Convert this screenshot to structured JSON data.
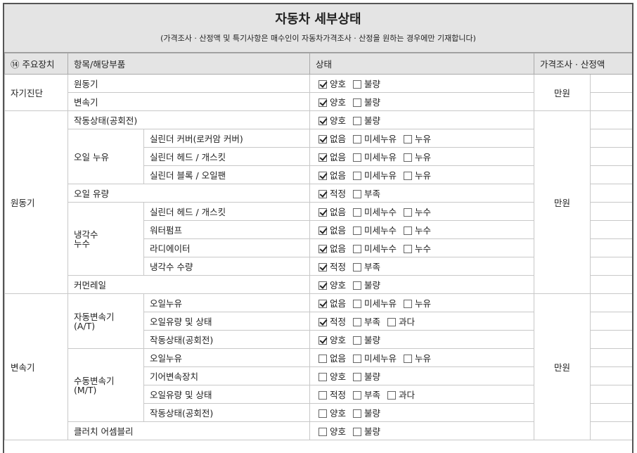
{
  "header": {
    "title": "자동차 세부상태",
    "subtitle": "(가격조사 · 산정액 및 특기사항은 매수인이 자동차가격조사 · 산정을 원하는 경우에만 기재합니다)"
  },
  "columns": {
    "device": "⑭ 주요장치",
    "item": "항목/해당부품",
    "state": "상태",
    "price": "가격조사 · 산정액"
  },
  "groups": {
    "selfdiag": "자기진단",
    "engine": "원동기",
    "transmission": "변속기",
    "oil_leak": "오일 누유",
    "coolant_leak": "냉각수\n누수",
    "auto_trans": "자동변속기\n(A/T)",
    "manual_trans": "수동변속기\n(M/T)"
  },
  "price_unit": "만원",
  "rows": [
    {
      "item": "원동기",
      "options": [
        {
          "label": "양호",
          "checked": true
        },
        {
          "label": "불량",
          "checked": false
        }
      ]
    },
    {
      "item": "변속기",
      "options": [
        {
          "label": "양호",
          "checked": true
        },
        {
          "label": "불량",
          "checked": false
        }
      ]
    },
    {
      "item": "작동상태(공회전)",
      "options": [
        {
          "label": "양호",
          "checked": true
        },
        {
          "label": "불량",
          "checked": false
        }
      ]
    },
    {
      "item": "실린더 커버(로커암 커버)",
      "options": [
        {
          "label": "없음",
          "checked": true
        },
        {
          "label": "미세누유",
          "checked": false
        },
        {
          "label": "누유",
          "checked": false
        }
      ]
    },
    {
      "item": "실린더 헤드 / 개스킷",
      "options": [
        {
          "label": "없음",
          "checked": true
        },
        {
          "label": "미세누유",
          "checked": false
        },
        {
          "label": "누유",
          "checked": false
        }
      ]
    },
    {
      "item": "실린더 블록 / 오일팬",
      "options": [
        {
          "label": "없음",
          "checked": true
        },
        {
          "label": "미세누유",
          "checked": false
        },
        {
          "label": "누유",
          "checked": false
        }
      ]
    },
    {
      "item": "오일 유량",
      "options": [
        {
          "label": "적정",
          "checked": true
        },
        {
          "label": "부족",
          "checked": false
        }
      ]
    },
    {
      "item": "실린더 헤드 / 개스킷",
      "options": [
        {
          "label": "없음",
          "checked": true
        },
        {
          "label": "미세누수",
          "checked": false
        },
        {
          "label": "누수",
          "checked": false
        }
      ]
    },
    {
      "item": "워터펌프",
      "options": [
        {
          "label": "없음",
          "checked": true
        },
        {
          "label": "미세누수",
          "checked": false
        },
        {
          "label": "누수",
          "checked": false
        }
      ]
    },
    {
      "item": "라디에이터",
      "options": [
        {
          "label": "없음",
          "checked": true
        },
        {
          "label": "미세누수",
          "checked": false
        },
        {
          "label": "누수",
          "checked": false
        }
      ]
    },
    {
      "item": "냉각수 수량",
      "options": [
        {
          "label": "적정",
          "checked": true
        },
        {
          "label": "부족",
          "checked": false
        }
      ]
    },
    {
      "item": "커먼레일",
      "options": [
        {
          "label": "양호",
          "checked": true
        },
        {
          "label": "불량",
          "checked": false
        }
      ]
    },
    {
      "item": "오일누유",
      "options": [
        {
          "label": "없음",
          "checked": true
        },
        {
          "label": "미세누유",
          "checked": false
        },
        {
          "label": "누유",
          "checked": false
        }
      ]
    },
    {
      "item": "오일유량 및 상태",
      "options": [
        {
          "label": "적정",
          "checked": true
        },
        {
          "label": "부족",
          "checked": false
        },
        {
          "label": "과다",
          "checked": false
        }
      ]
    },
    {
      "item": "작동상태(공회전)",
      "options": [
        {
          "label": "양호",
          "checked": true
        },
        {
          "label": "불량",
          "checked": false
        }
      ]
    },
    {
      "item": "오일누유",
      "options": [
        {
          "label": "없음",
          "checked": false
        },
        {
          "label": "미세누유",
          "checked": false
        },
        {
          "label": "누유",
          "checked": false
        }
      ]
    },
    {
      "item": "기어변속장치",
      "options": [
        {
          "label": "양호",
          "checked": false
        },
        {
          "label": "불량",
          "checked": false
        }
      ]
    },
    {
      "item": "오일유량 및 상태",
      "options": [
        {
          "label": "적정",
          "checked": false
        },
        {
          "label": "부족",
          "checked": false
        },
        {
          "label": "과다",
          "checked": false
        }
      ]
    },
    {
      "item": "작동상태(공회전)",
      "options": [
        {
          "label": "양호",
          "checked": false
        },
        {
          "label": "불량",
          "checked": false
        }
      ]
    },
    {
      "item": "클러치 어셈블리",
      "options": [
        {
          "label": "양호",
          "checked": false
        },
        {
          "label": "불량",
          "checked": false
        }
      ]
    }
  ]
}
